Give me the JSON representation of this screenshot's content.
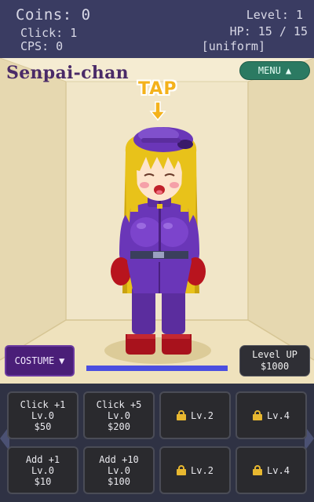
{
  "hud": {
    "coins": "Coins: 0",
    "click": "Click: 1",
    "cps": "CPS: 0",
    "level": "Level: 1",
    "hp": "HP: 15 / 15",
    "outfit": "[uniform]"
  },
  "room": {
    "character_name": "Senpai-chan",
    "menu_label": "MENU",
    "menu_icon": "triangle-up-icon",
    "tap_label": "TAP",
    "costume_label": "COSTUME",
    "costume_icon": "triangle-down-icon",
    "levelup_label": "Level UP",
    "levelup_cost": "$1000",
    "progress": 1.0
  },
  "shop": {
    "row1": [
      {
        "label": "Click +1",
        "lv": "Lv.0",
        "cost": "$50"
      },
      {
        "label": "Click +5",
        "lv": "Lv.0",
        "cost": "$200"
      },
      {
        "locked": "Lv.2"
      },
      {
        "locked": "Lv.4"
      }
    ],
    "row2": [
      {
        "label": "Add +1",
        "lv": "Lv.0",
        "cost": "$10"
      },
      {
        "label": "Add +10",
        "lv": "Lv.0",
        "cost": "$100"
      },
      {
        "locked": "Lv.2"
      },
      {
        "locked": "Lv.4"
      }
    ]
  },
  "colors": {
    "hud_bg": "#3a3c62",
    "room_wall": "#f1e6c8",
    "name_color": "#4a2a68",
    "menu_bg": "#2b7a62",
    "costume_bg": "#4a1e78",
    "progress_fill": "#4b4ee0",
    "tap_color": "#f4b21c",
    "hair": "#e8c21a",
    "suit": "#6a36b8",
    "gloves": "#b8141e",
    "lock_color": "#e8b830"
  }
}
